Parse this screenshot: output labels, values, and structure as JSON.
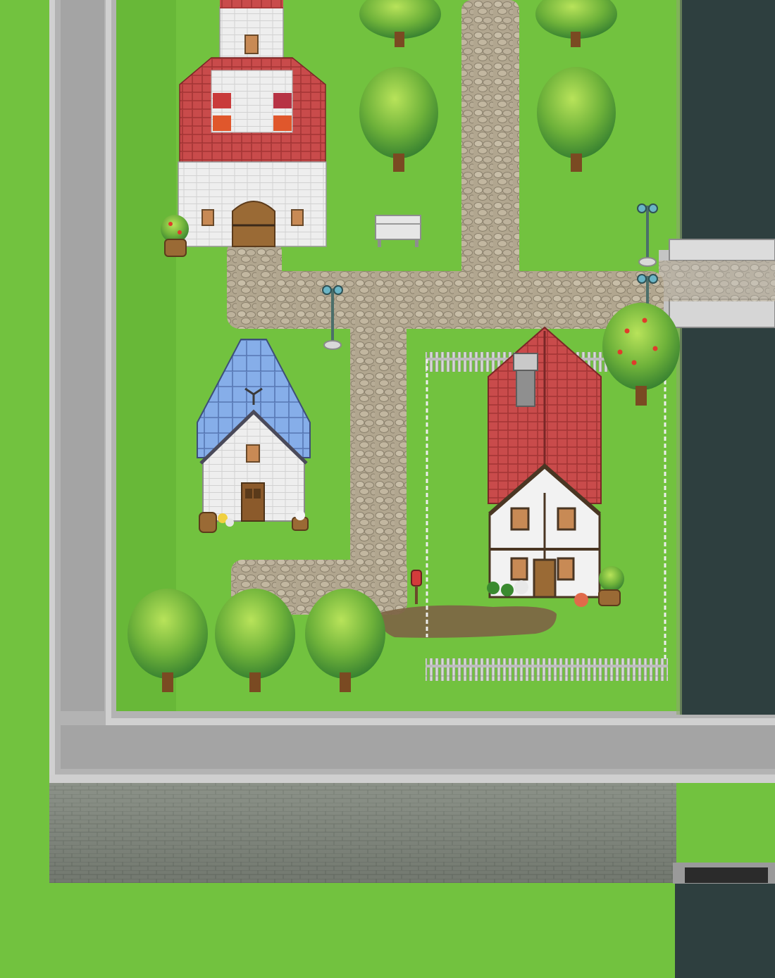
{
  "scene": {
    "type": "top-down-rpg-map",
    "palette": {
      "grass": "#72c23f",
      "grass_dark": "#5faa33",
      "stone_path": "#b7ab95",
      "wall_gray": "#9c9c9c",
      "wall_light": "#c8c8c8",
      "water": "#2f4040",
      "roof_red": "#c94b4b",
      "roof_blue": "#7ea6e6",
      "tree_dark": "#3e8d2f",
      "tree_light": "#8fd04a",
      "wood": "#8a5a2a"
    },
    "objects": {
      "church": "church",
      "blue_roof_house": "house-blue-roof",
      "red_roof_house": "house-red-roof",
      "bridge": "bridge",
      "bench": "bench",
      "mailbox": "mailbox"
    }
  }
}
